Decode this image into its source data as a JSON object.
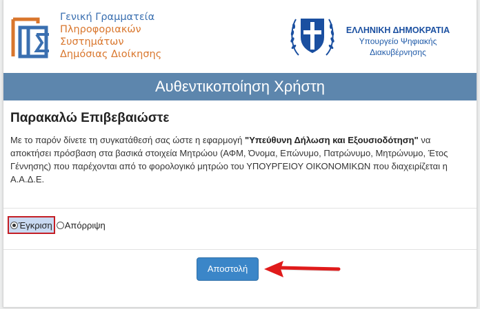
{
  "header": {
    "gsis": {
      "line1": "Γενική Γραμματεία",
      "line2": "Πληροφοριακών",
      "line3": "Συστημάτων",
      "line4": "Δημόσιας Διοίκησης"
    },
    "government": {
      "title": "ΕΛΛΗΝΙΚΗ ΔΗΜΟΚΡΑΤΙΑ",
      "ministry_line1": "Υπουργείο Ψηφιακής",
      "ministry_line2": "Διακυβέρνησης"
    }
  },
  "title_bar": "Αυθεντικοποίηση Χρήστη",
  "main": {
    "heading": "Παρακαλώ Επιβεβαιώστε",
    "consent_part1": "Με το παρόν δίνετε τη συγκατάθεσή σας ώστε η εφαρμογή ",
    "app_name": "\"Υπεύθυνη Δήλωση και Εξουσιοδότηση\"",
    "consent_part2": " να αποκτήσει πρόσβαση στα βασικά στοιχεία Μητρώου (ΑΦΜ, Όνομα, Επώνυμο, Πατρώνυμο, Μητρώνυμο, Έτος Γέννησης) που παρέχονται από το φορολογικό μητρώο του ΥΠΟΥΡΓΕΙΟΥ ΟΙΚΟΝΟΜΙΚΩΝ που διαχειρίζεται η Α.Α.Δ.Ε."
  },
  "options": {
    "approve_label": "Έγκριση",
    "reject_label": "Απόρριψη",
    "selected": "approve"
  },
  "submit_label": "Αποστολή",
  "colors": {
    "title_bar": "#5d86ad",
    "button": "#3b86c8",
    "highlight_border": "#c41e25",
    "arrow": "#e01b1b"
  }
}
